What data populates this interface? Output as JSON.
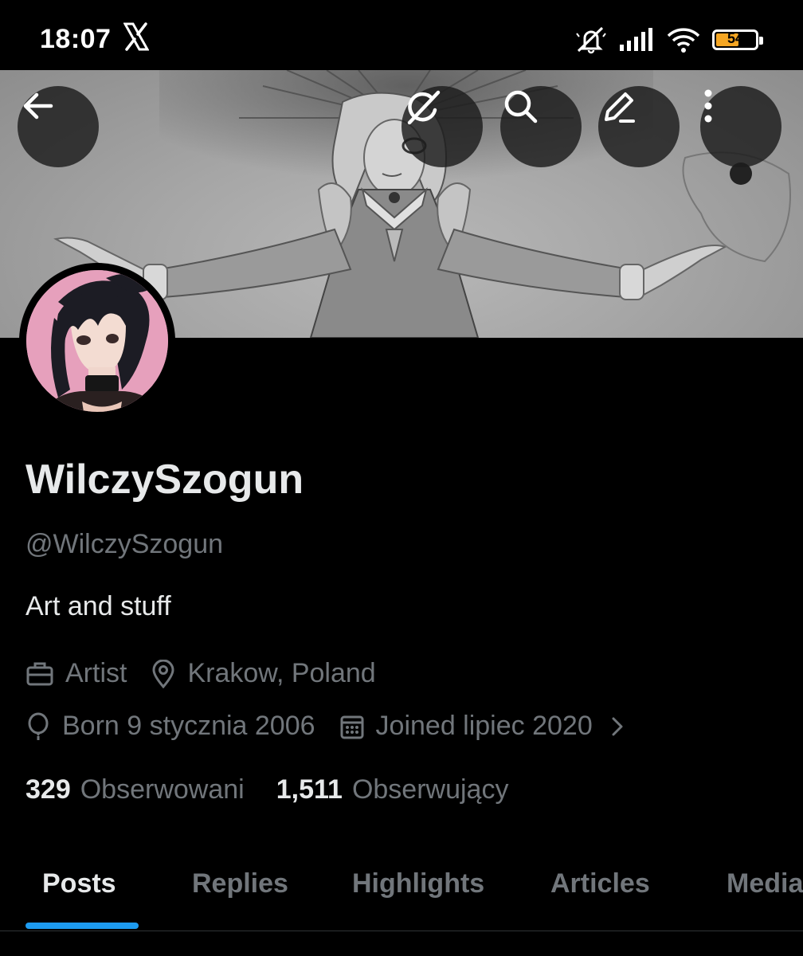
{
  "status_bar": {
    "time": "18:07",
    "battery_level": "54",
    "icons": [
      "x-logo-icon",
      "mute-icon",
      "signal-icon",
      "wifi-icon",
      "battery-icon"
    ]
  },
  "header": {
    "buttons": [
      "back-arrow-icon",
      "grok-icon",
      "search-icon",
      "edit-icon",
      "more-vertical-icon"
    ]
  },
  "profile": {
    "display_name": "WilczySzogun",
    "handle": "@WilczySzogun",
    "bio": "Art and stuff",
    "profession": "Artist",
    "location": "Krakow, Poland",
    "birth": "Born 9 stycznia 2006",
    "joined": "Joined lipiec 2020"
  },
  "stats": {
    "following_count": "329",
    "following_label": "Obserwowani",
    "followers_count": "1,511",
    "followers_label": "Obserwujący"
  },
  "tabs": [
    {
      "label": "Posts",
      "active": true
    },
    {
      "label": "Replies",
      "active": false
    },
    {
      "label": "Highlights",
      "active": false
    },
    {
      "label": "Articles",
      "active": false
    },
    {
      "label": "Media",
      "active": false
    }
  ],
  "colors": {
    "background": "#000000",
    "text_primary": "#e7e9ea",
    "text_secondary": "#71767b",
    "accent": "#1d9bf0",
    "battery": "#f5a623"
  }
}
